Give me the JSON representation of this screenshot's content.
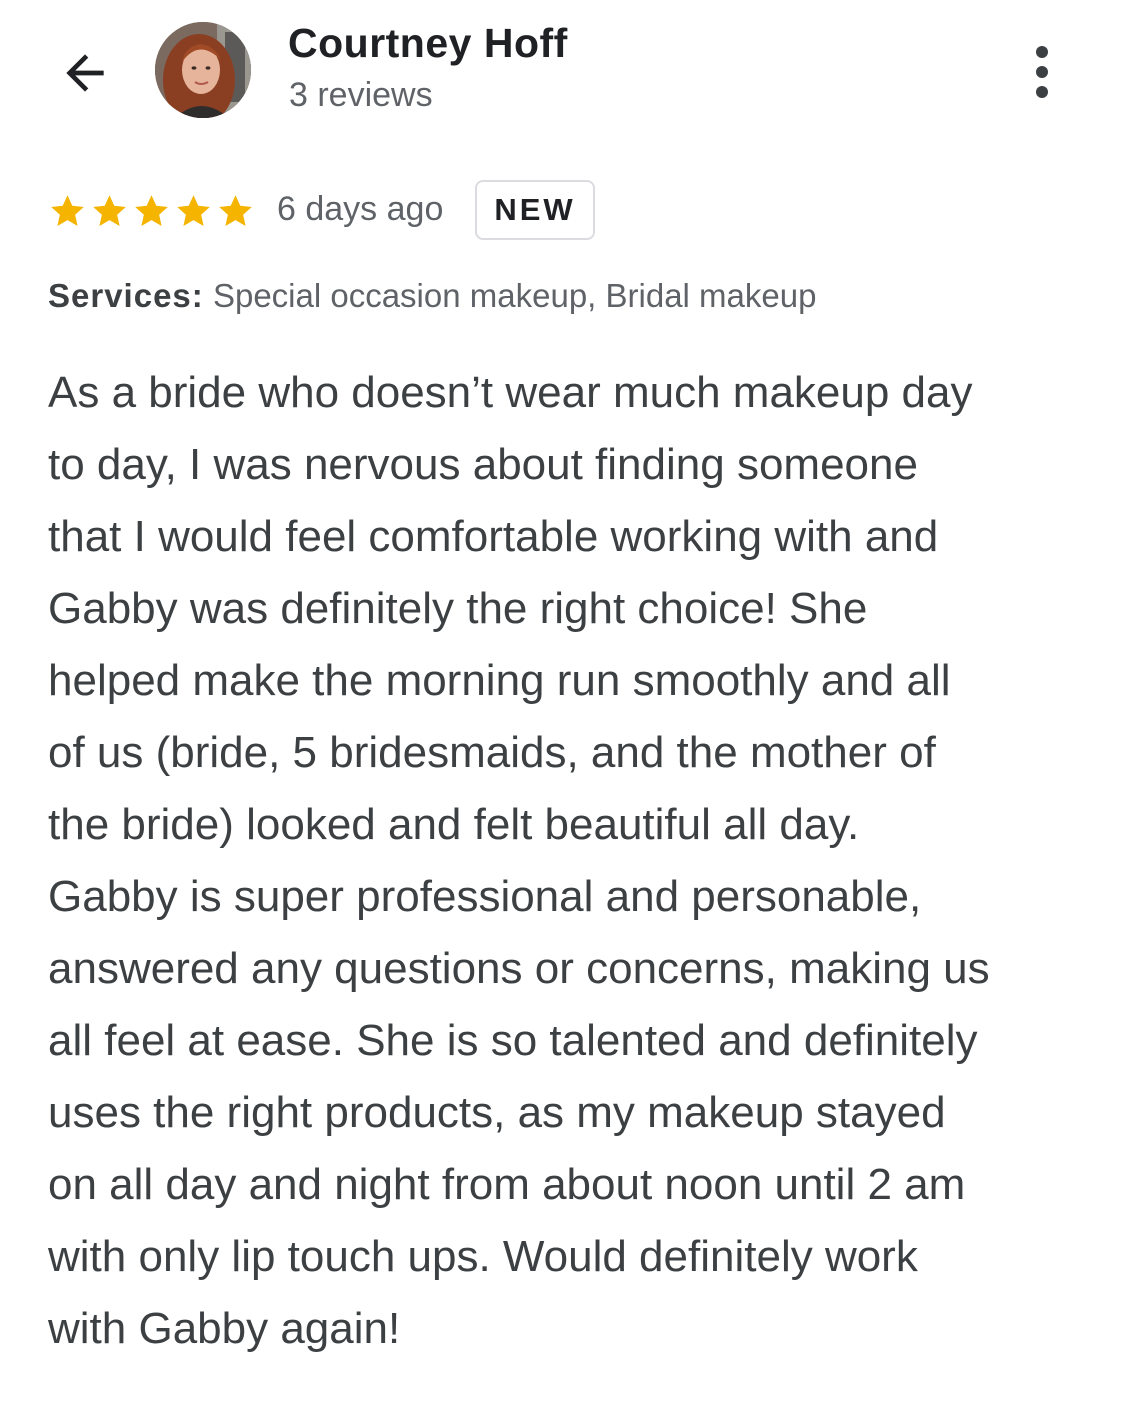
{
  "header": {
    "back_icon": "arrow-back-icon",
    "reviewer_name": "Courtney Hoff",
    "review_count": "3 reviews",
    "more_icon": "more-vertical-icon"
  },
  "review": {
    "rating": 5,
    "rating_max": 5,
    "star_color": "#f4b400",
    "time": "6 days ago",
    "badge": "NEW",
    "services_label": "Services:",
    "services_value": "Special occasion makeup, Bridal makeup",
    "text_lines": [
      "As a bride who doesn’t wear much makeup day",
      "to day, I was nervous about finding someone",
      "that I would feel comfortable working with and",
      "Gabby was definitely the right choice! She",
      "helped make the morning run smoothly and all",
      "of us (bride, 5 bridesmaids, and the mother of",
      "the bride) looked and felt beautiful all day.",
      "Gabby is super professional and personable,",
      "answered any questions or concerns, making us",
      "all feel at ease. She is so talented and definitely",
      "uses the right products, as my makeup stayed",
      "on all day and night from about noon until 2 am",
      "with only lip touch ups. Would definitely work",
      "with Gabby again!"
    ]
  }
}
